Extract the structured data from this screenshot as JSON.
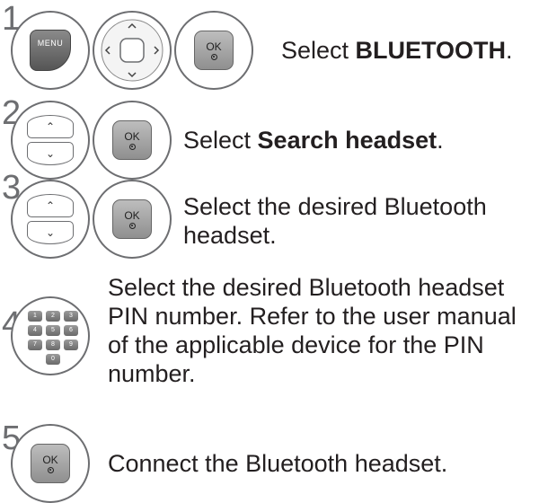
{
  "steps": [
    {
      "number": "1",
      "text_prefix": "Select ",
      "text_bold": "BLUETOOTH",
      "text_suffix": ".",
      "buttons": {
        "menu_label": "MENU",
        "ok_label": "OK"
      }
    },
    {
      "number": "2",
      "text_prefix": "Select ",
      "text_bold": "Search headset",
      "text_suffix": ".",
      "buttons": {
        "ok_label": "OK"
      }
    },
    {
      "number": "3",
      "text_line1": "Select the desired Bluetooth",
      "text_line2": "headset.",
      "buttons": {
        "ok_label": "OK"
      }
    },
    {
      "number": "4",
      "text_lines": [
        "Select the desired Bluetooth headset",
        "PIN number. Refer to the user manual",
        "of the applicable device for the PIN",
        "number."
      ],
      "keypad": [
        "1",
        "2",
        "3",
        "4",
        "5",
        "6",
        "7",
        "8",
        "9",
        "0"
      ]
    },
    {
      "number": "5",
      "text": "Connect the Bluetooth headset.",
      "buttons": {
        "ok_label": "OK"
      }
    }
  ],
  "icons": [
    "menu-button-icon",
    "dpad-icon",
    "ok-button-icon",
    "up-down-button-icon",
    "number-keypad-icon"
  ],
  "colors": {
    "text": "#231f20",
    "outline": "#6d6e71",
    "button_grey": "#a6a6a6"
  }
}
